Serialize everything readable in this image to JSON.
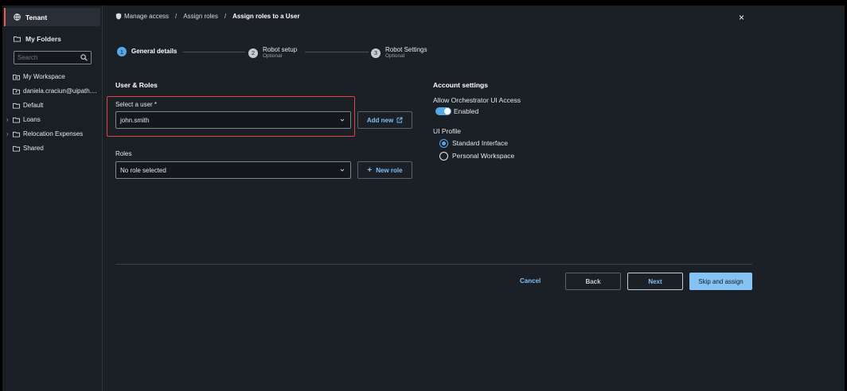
{
  "sidebar": {
    "tenant_label": "Tenant",
    "my_folders_label": "My Folders",
    "search_placeholder": "Search",
    "items": [
      {
        "label": "My Workspace",
        "expandable": false,
        "icon": "workspace-icon"
      },
      {
        "label": "daniela.craciun@uipath....",
        "expandable": false,
        "icon": "folder-user-icon"
      },
      {
        "label": "Default",
        "expandable": false,
        "icon": "folder-icon"
      },
      {
        "label": "Loans",
        "expandable": true,
        "icon": "folder-icon"
      },
      {
        "label": "Relocation Expenses",
        "expandable": true,
        "icon": "folder-icon"
      },
      {
        "label": "Shared",
        "expandable": false,
        "icon": "folder-icon"
      }
    ]
  },
  "breadcrumb": {
    "items": [
      "Manage access",
      "Assign roles",
      "Assign roles to a User"
    ],
    "separator": "/"
  },
  "close_symbol": "×",
  "stepper": {
    "steps": [
      {
        "number": "1",
        "label": "General details",
        "sub": ""
      },
      {
        "number": "2",
        "label": "Robot setup",
        "sub": "Optional"
      },
      {
        "number": "3",
        "label": "Robot Settings",
        "sub": "Optional"
      }
    ]
  },
  "user_roles": {
    "title": "User & Roles",
    "select_user_label": "Select a user *",
    "select_user_value": "john.smith",
    "add_new_label": "Add new",
    "roles_label": "Roles",
    "roles_value": "No role selected",
    "new_role_label": "New role",
    "new_role_prefix": "+"
  },
  "account_settings": {
    "title": "Account settings",
    "ui_access_label": "Allow Orchestrator UI Access",
    "ui_access_state": "Enabled",
    "ui_profile_label": "UI Profile",
    "profile_options": [
      "Standard Interface",
      "Personal Workspace"
    ],
    "selected_profile": "Standard Interface"
  },
  "footer": {
    "cancel_label": "Cancel",
    "back_label": "Back",
    "next_label": "Next",
    "skip_label": "Skip and assign"
  },
  "colors": {
    "accent": "#5aa7e6",
    "link": "#7fc0f5",
    "highlight_border": "#e04343",
    "tenant_marker": "#e0614b"
  }
}
